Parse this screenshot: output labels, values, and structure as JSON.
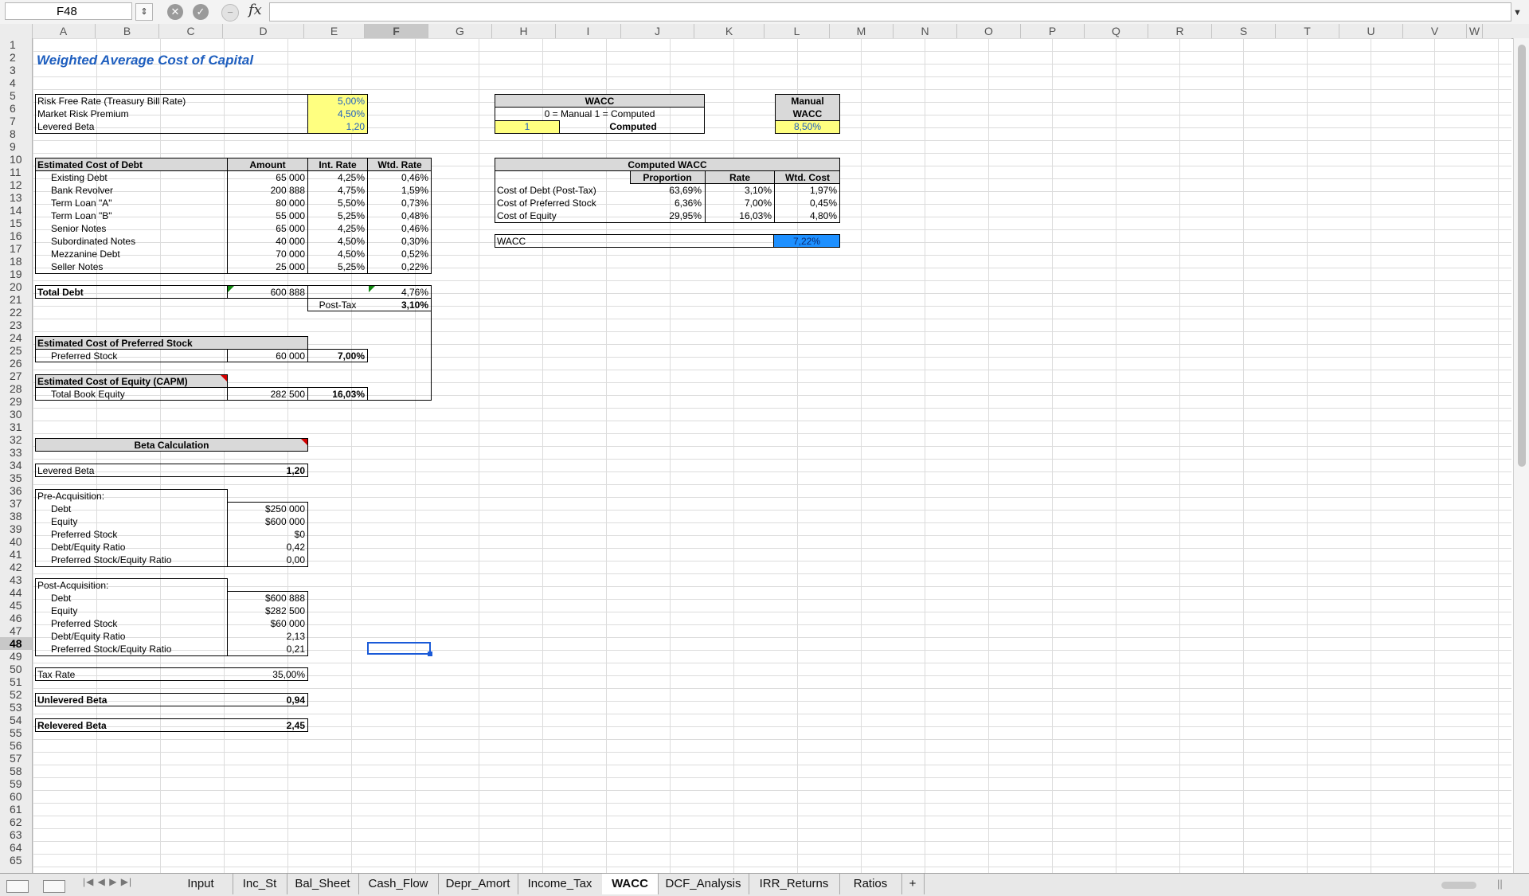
{
  "formula_bar": {
    "cell_ref": "F48",
    "formula": ""
  },
  "columns": [
    "A",
    "B",
    "C",
    "D",
    "E",
    "F",
    "G",
    "H",
    "I",
    "J",
    "K",
    "L",
    "M",
    "N",
    "O",
    "P",
    "Q",
    "R",
    "S",
    "T",
    "U",
    "V",
    "W"
  ],
  "rows": [
    "1",
    "2",
    "3",
    "4",
    "5",
    "6",
    "7",
    "8",
    "9",
    "10",
    "11",
    "12",
    "13",
    "14",
    "15",
    "16",
    "17",
    "18",
    "19",
    "20",
    "21",
    "22",
    "23",
    "24",
    "25",
    "26",
    "27",
    "28",
    "29",
    "30",
    "31",
    "32",
    "33",
    "34",
    "35",
    "36",
    "37",
    "38",
    "39",
    "40",
    "41",
    "42",
    "43",
    "44",
    "45",
    "46",
    "47",
    "48",
    "49",
    "50",
    "51",
    "52",
    "53",
    "54",
    "55",
    "56",
    "57",
    "58",
    "59",
    "60",
    "61",
    "62",
    "63",
    "64",
    "65"
  ],
  "title": "Weighted Average Cost of Capital",
  "inputs": [
    {
      "label": "Risk Free Rate (Treasury Bill Rate)",
      "value": "5,00%"
    },
    {
      "label": "Market Risk Premium",
      "value": "4,50%"
    },
    {
      "label": "Levered Beta",
      "value": "1,20"
    }
  ],
  "wacc_switch": {
    "title": "WACC",
    "legend": "0 = Manual    1 = Computed",
    "value": "1",
    "mode": "Computed"
  },
  "manual_wacc": {
    "line1": "Manual",
    "line2": "WACC",
    "value": "8,50%"
  },
  "debt": {
    "headers": [
      "Estimated Cost of Debt",
      "Amount",
      "Int. Rate",
      "Wtd. Rate"
    ],
    "items": [
      {
        "name": "Existing Debt",
        "amount": "65 000",
        "rate": "4,25%",
        "wtd": "0,46%"
      },
      {
        "name": "Bank Revolver",
        "amount": "200 888",
        "rate": "4,75%",
        "wtd": "1,59%"
      },
      {
        "name": "Term Loan \"A\"",
        "amount": "80 000",
        "rate": "5,50%",
        "wtd": "0,73%"
      },
      {
        "name": "Term Loan \"B\"",
        "amount": "55 000",
        "rate": "5,25%",
        "wtd": "0,48%"
      },
      {
        "name": "Senior Notes",
        "amount": "65 000",
        "rate": "4,25%",
        "wtd": "0,46%"
      },
      {
        "name": "Subordinated Notes",
        "amount": "40 000",
        "rate": "4,50%",
        "wtd": "0,30%"
      },
      {
        "name": "Mezzanine Debt",
        "amount": "70 000",
        "rate": "4,50%",
        "wtd": "0,52%"
      },
      {
        "name": "Seller Notes",
        "amount": "25 000",
        "rate": "5,25%",
        "wtd": "0,22%"
      }
    ],
    "total_label": "Total Debt",
    "total_amount": "600 888",
    "total_wtd": "4,76%",
    "post_tax_label": "Post-Tax",
    "post_tax": "3,10%"
  },
  "preferred": {
    "header": "Estimated Cost of Preferred Stock",
    "label": "Preferred Stock",
    "amount": "60 000",
    "rate": "7,00%"
  },
  "equity": {
    "header": "Estimated Cost of Equity (CAPM)",
    "label": "Total Book Equity",
    "amount": "282 500",
    "rate": "16,03%"
  },
  "computed": {
    "title": "Computed WACC",
    "headers": [
      "Proportion",
      "Rate",
      "Wtd. Cost"
    ],
    "rows": [
      {
        "label": "Cost of Debt (Post-Tax)",
        "prop": "63,69%",
        "rate": "3,10%",
        "cost": "1,97%"
      },
      {
        "label": "Cost of Preferred Stock",
        "prop": "6,36%",
        "rate": "7,00%",
        "cost": "0,45%"
      },
      {
        "label": "Cost of Equity",
        "prop": "29,95%",
        "rate": "16,03%",
        "cost": "4,80%"
      }
    ],
    "wacc_label": "WACC",
    "wacc_value": "7,22%"
  },
  "beta": {
    "title": "Beta Calculation",
    "levered_label": "Levered Beta",
    "levered": "1,20",
    "pre_label": "Pre-Acquisition:",
    "pre": [
      {
        "label": "Debt",
        "value": "$250 000"
      },
      {
        "label": "Equity",
        "value": "$600 000"
      },
      {
        "label": "Preferred Stock",
        "value": "$0"
      },
      {
        "label": "Debt/Equity Ratio",
        "value": "0,42"
      },
      {
        "label": "Preferred Stock/Equity Ratio",
        "value": "0,00"
      }
    ],
    "post_label": "Post-Acquisition:",
    "post": [
      {
        "label": "Debt",
        "value": "$600 888"
      },
      {
        "label": "Equity",
        "value": "$282 500"
      },
      {
        "label": "Preferred Stock",
        "value": "$60 000"
      },
      {
        "label": "Debt/Equity Ratio",
        "value": "2,13"
      },
      {
        "label": "Preferred Stock/Equity Ratio",
        "value": "0,21"
      }
    ],
    "tax_label": "Tax Rate",
    "tax": "35,00%",
    "unlevered_label": "Unlevered Beta",
    "unlevered": "0,94",
    "relevered_label": "Relevered Beta",
    "relevered": "2,45"
  },
  "sheets": [
    "Input",
    "Inc_St",
    "Bal_Sheet",
    "Cash_Flow",
    "Depr_Amort",
    "Income_Tax",
    "WACC",
    "DCF_Analysis",
    "IRR_Returns",
    "Ratios",
    "+"
  ],
  "active_sheet": "WACC",
  "nav_arrows": "|◀ ◀ ▶ ▶|"
}
